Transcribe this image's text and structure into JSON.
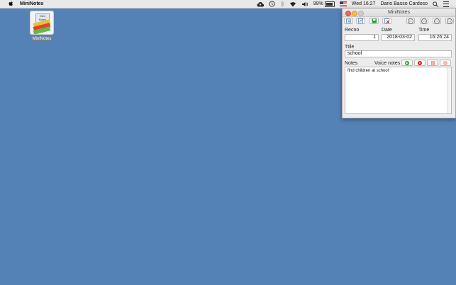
{
  "menubar": {
    "app_name": "MiniNotes",
    "battery_percent": "99%",
    "clock": "Wed 16:27",
    "user_name": "Dario Basso Cardoso",
    "icons": [
      "apple-icon",
      "cloud-upload-icon",
      "time-machine-icon",
      "bluetooth-icon",
      "wifi-icon",
      "volume-icon",
      "battery-icon",
      "flag-icon",
      "search-icon",
      "list-icon"
    ]
  },
  "desktop": {
    "icon_label": "MiniNotes",
    "icon_paper_text": "Mini Notes"
  },
  "window": {
    "title": "MiniNotes",
    "toolbar": {
      "left_icons": [
        "new-record-icon",
        "edit-record-icon",
        "save-record-icon",
        "delete-record-icon"
      ],
      "nav_icons": [
        "first-record-icon",
        "previous-record-icon",
        "next-record-icon",
        "last-record-icon"
      ]
    },
    "recno_label": "Recno",
    "recno_value": "1",
    "date_label": "Date",
    "date_value": "2018-03-02",
    "time_label": "Time",
    "time_value": "16:26:24",
    "title_label": "Ttile",
    "title_value": "school",
    "notes_label": "Notes",
    "voice_notes_label": "Voice notes",
    "voice_buttons": [
      "play-icon",
      "record-icon",
      "pause-icon",
      "stop-icon"
    ],
    "notes_text": "find children at school"
  },
  "colors": {
    "desktop_bg": "#5582b6",
    "play": "#2a9d3a",
    "record": "#cc2222"
  }
}
